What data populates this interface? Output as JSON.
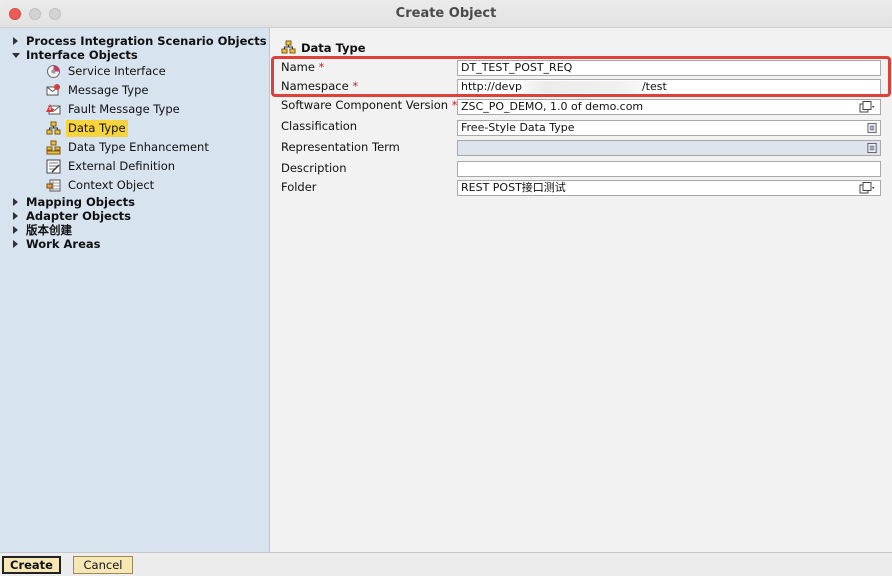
{
  "window": {
    "title": "Create Object"
  },
  "tree": {
    "items": [
      {
        "label": "Process Integration Scenario Objects",
        "expanded": false
      },
      {
        "label": "Interface Objects",
        "expanded": true
      },
      {
        "label": "Mapping Objects",
        "expanded": false
      },
      {
        "label": "Adapter Objects",
        "expanded": false
      },
      {
        "label": "版本创建",
        "expanded": false
      },
      {
        "label": "Work Areas",
        "expanded": false
      }
    ],
    "children": [
      {
        "label": "Service Interface",
        "icon": "service-interface-icon"
      },
      {
        "label": "Message Type",
        "icon": "message-type-icon"
      },
      {
        "label": "Fault Message Type",
        "icon": "fault-message-type-icon"
      },
      {
        "label": "Data Type",
        "icon": "data-type-icon",
        "selected": true
      },
      {
        "label": "Data Type Enhancement",
        "icon": "data-type-enhancement-icon"
      },
      {
        "label": "External Definition",
        "icon": "external-definition-icon"
      },
      {
        "label": "Context Object",
        "icon": "context-object-icon"
      }
    ]
  },
  "form": {
    "header": "Data Type",
    "fields": [
      {
        "label": "Name",
        "required_mark": "*",
        "value": "DT_TEST_POST_REQ"
      },
      {
        "label": "Namespace",
        "required_mark": "*",
        "value_prefix": "http://devp",
        "value_suffix": "/test"
      },
      {
        "label": "Software Component Version",
        "required_mark": "*",
        "value": "ZSC_PO_DEMO, 1.0 of demo.com"
      },
      {
        "label": "Classification",
        "required_mark": "",
        "value": "Free-Style Data Type"
      },
      {
        "label": "Representation Term",
        "required_mark": "",
        "value": ""
      },
      {
        "label": "Description",
        "required_mark": "",
        "value": ""
      },
      {
        "label": "Folder",
        "required_mark": "",
        "value": "REST POST接口测试"
      }
    ]
  },
  "buttons": {
    "create": "Create",
    "cancel": "Cancel"
  },
  "colors": {
    "sidebar_bg": "#d7e3ee",
    "selection": "#f7d33d",
    "highlight_box": "#e0403a",
    "button_bg": "#f7e7b5",
    "required": "#cc2222"
  }
}
